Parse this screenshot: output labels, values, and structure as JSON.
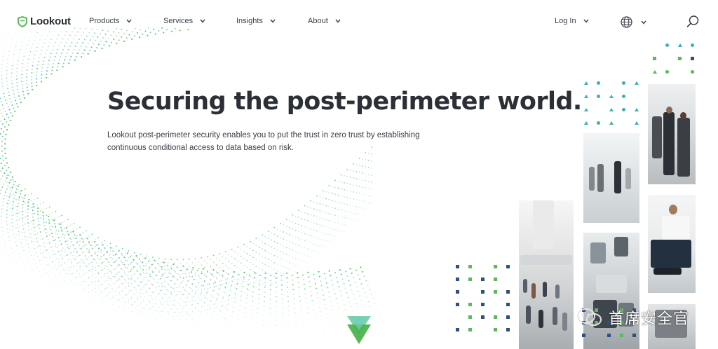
{
  "brand": {
    "name": "Lookout",
    "accent": "#5cb85c"
  },
  "nav": {
    "items": [
      {
        "label": "Products"
      },
      {
        "label": "Services"
      },
      {
        "label": "Insights"
      },
      {
        "label": "About"
      }
    ],
    "login_label": "Log In",
    "icons": {
      "language": "globe-icon",
      "search": "search-icon"
    }
  },
  "hero": {
    "title": "Securing the post-perimeter world.",
    "subtitle": "Lookout post-perimeter security enables you to put the trust in zero trust by establishing continuous conditional access to data based on risk."
  },
  "watermark": {
    "text": "首席安全官"
  },
  "colors": {
    "green": "#5cb85c",
    "teal": "#3fb0b0",
    "navy": "#2f4f7f",
    "text": "#2b2f36"
  }
}
